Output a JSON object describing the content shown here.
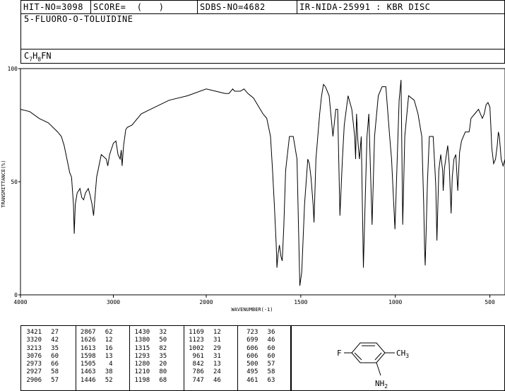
{
  "header": {
    "hit_no": "HIT-NO=3098",
    "score": "SCORE=  (   )",
    "sdbs_no": "SDBS-NO=4682",
    "ir_nida": "IR-NIDA-25991 : KBR DISC"
  },
  "compound_name": "5-FLUORO-O-TOLUIDINE",
  "formula": {
    "c": "C",
    "c_n": "7",
    "h": "H",
    "h_n": "8",
    "rest": "FN"
  },
  "structure": {
    "f_label": "F",
    "ch3_label": "CH3",
    "nh2_label": "NH2"
  },
  "chart_data": {
    "type": "line",
    "xlabel": "WAVENUMBER(-1)",
    "ylabel": "TRANSMITTANCE(%)",
    "x_ticks": [
      "4000",
      "3000",
      "2000",
      "1500",
      "1000",
      "500"
    ],
    "y_ticks": [
      "100",
      "50",
      "0"
    ],
    "ylim": [
      0,
      100
    ],
    "x": [
      4000,
      3900,
      3800,
      3700,
      3600,
      3560,
      3530,
      3500,
      3470,
      3450,
      3430,
      3421,
      3410,
      3390,
      3360,
      3340,
      3320,
      3300,
      3270,
      3250,
      3230,
      3213,
      3200,
      3180,
      3130,
      3076,
      3060,
      3040,
      3000,
      2973,
      2950,
      2927,
      2915,
      2906,
      2890,
      2870,
      2867,
      2850,
      2800,
      2700,
      2600,
      2400,
      2200,
      2000,
      1950,
      1900,
      1880,
      1860,
      1850,
      1820,
      1800,
      1780,
      1750,
      1700,
      1680,
      1660,
      1650,
      1640,
      1630,
      1626,
      1620,
      1613,
      1605,
      1598,
      1590,
      1580,
      1560,
      1540,
      1520,
      1505,
      1495,
      1480,
      1463,
      1455,
      1446,
      1435,
      1430,
      1420,
      1400,
      1390,
      1380,
      1370,
      1350,
      1330,
      1315,
      1305,
      1293,
      1285,
      1280,
      1270,
      1250,
      1230,
      1215,
      1210,
      1205,
      1198,
      1190,
      1180,
      1169,
      1160,
      1150,
      1140,
      1123,
      1110,
      1090,
      1070,
      1050,
      1030,
      1020,
      1002,
      990,
      980,
      970,
      961,
      950,
      930,
      900,
      880,
      860,
      850,
      845,
      842,
      838,
      830,
      820,
      800,
      790,
      786,
      780,
      770,
      760,
      750,
      747,
      740,
      730,
      723,
      715,
      705,
      699,
      690,
      680,
      670,
      660,
      650,
      630,
      610,
      606,
      600,
      580,
      560,
      540,
      530,
      520,
      510,
      500,
      495,
      490,
      480,
      470,
      461,
      455,
      450,
      440,
      430,
      420
    ],
    "y": [
      82,
      81,
      78,
      76,
      72,
      70,
      66,
      60,
      54,
      52,
      40,
      27,
      40,
      45,
      47,
      43,
      42,
      45,
      47,
      44,
      40,
      35,
      42,
      52,
      62,
      60,
      57,
      62,
      67,
      68,
      62,
      60,
      64,
      57,
      66,
      72,
      73,
      74,
      75,
      80,
      82,
      86,
      88,
      91,
      90,
      89,
      89,
      91,
      90,
      90,
      91,
      89,
      87,
      80,
      78,
      70,
      56,
      40,
      22,
      12,
      18,
      22,
      17,
      15,
      30,
      55,
      70,
      70,
      60,
      4,
      10,
      40,
      60,
      58,
      52,
      40,
      32,
      60,
      80,
      88,
      93,
      92,
      88,
      70,
      82,
      82,
      35,
      50,
      60,
      75,
      88,
      82,
      70,
      60,
      80,
      68,
      60,
      70,
      12,
      40,
      70,
      80,
      31,
      70,
      88,
      92,
      92,
      70,
      60,
      29,
      60,
      86,
      95,
      31,
      70,
      88,
      86,
      80,
      70,
      40,
      20,
      13,
      25,
      50,
      70,
      70,
      55,
      48,
      24,
      55,
      62,
      55,
      46,
      56,
      62,
      66,
      58,
      36,
      52,
      60,
      62,
      46,
      63,
      68,
      72,
      72,
      74,
      78,
      80,
      82,
      78,
      80,
      84,
      85,
      83,
      75,
      65,
      58,
      60,
      66,
      72,
      70,
      60,
      57,
      60,
      66,
      72,
      74,
      75
    ]
  },
  "peak_table": [
    [
      [
        "3421",
        "27"
      ],
      [
        "3320",
        "42"
      ],
      [
        "3213",
        "35"
      ],
      [
        "3076",
        "60"
      ],
      [
        "2973",
        "66"
      ],
      [
        "2927",
        "58"
      ],
      [
        "2906",
        "57"
      ]
    ],
    [
      [
        "2867",
        "62"
      ],
      [
        "1626",
        "12"
      ],
      [
        "1613",
        "16"
      ],
      [
        "1598",
        "13"
      ],
      [
        "1505",
        "4"
      ],
      [
        "1463",
        "38"
      ],
      [
        "1446",
        "52"
      ]
    ],
    [
      [
        "1430",
        "32"
      ],
      [
        "1380",
        "50"
      ],
      [
        "1315",
        "82"
      ],
      [
        "1293",
        "35"
      ],
      [
        "1280",
        "20"
      ],
      [
        "1210",
        "80"
      ],
      [
        "1198",
        "68"
      ]
    ],
    [
      [
        "1169",
        "12"
      ],
      [
        "1123",
        "31"
      ],
      [
        "1002",
        "29"
      ],
      [
        "961",
        "31"
      ],
      [
        "842",
        "13"
      ],
      [
        "786",
        "24"
      ],
      [
        "747",
        "46"
      ]
    ],
    [
      [
        "723",
        "36"
      ],
      [
        "699",
        "46"
      ],
      [
        "606",
        "60"
      ],
      [
        "606",
        "60"
      ],
      [
        "500",
        "57"
      ],
      [
        "495",
        "58"
      ],
      [
        "461",
        "63"
      ]
    ]
  ]
}
